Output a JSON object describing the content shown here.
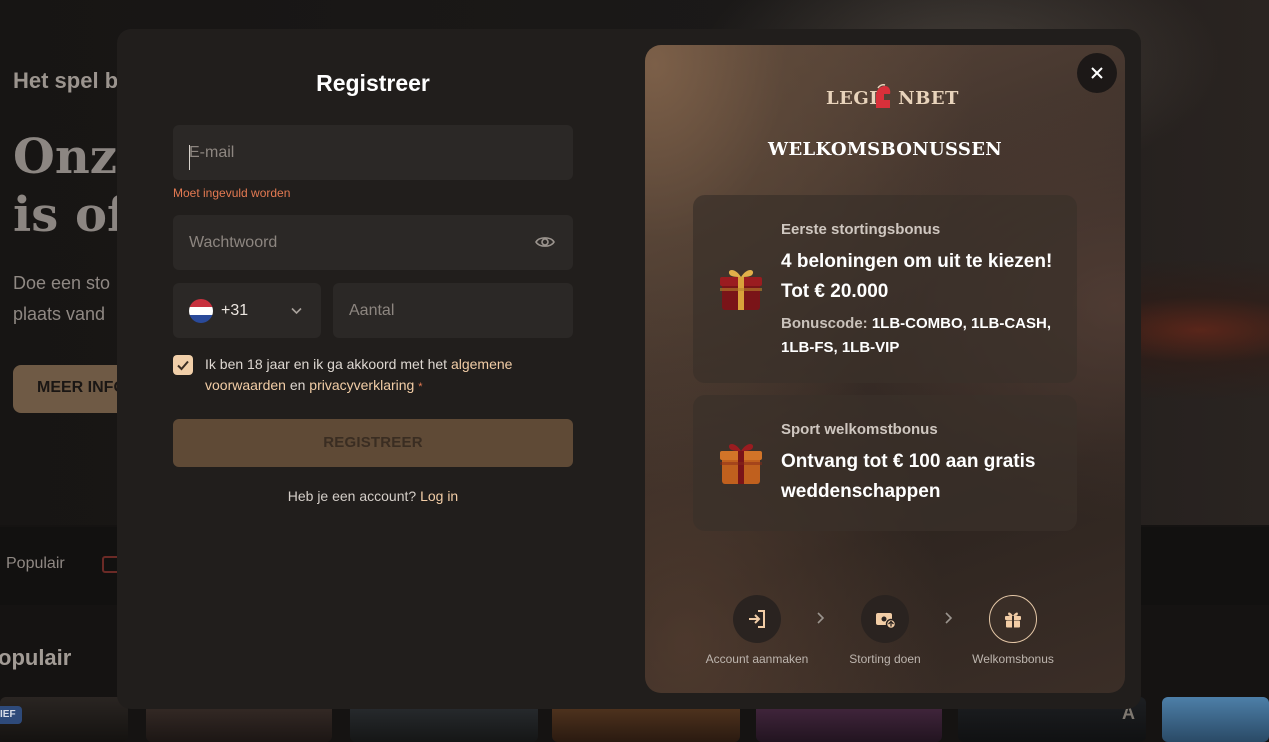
{
  "background": {
    "hero_subtitle": "Het spel b",
    "hero_title_line1": "Onze",
    "hero_title_line2": "is off",
    "hero_text_line1": "Doe een sto",
    "hero_text_line2": "plaats vand",
    "more_button": "MEER INFO",
    "nav_item": "Populair",
    "section_title": "opulair",
    "badge": "IEF",
    "tile_letter": "A"
  },
  "form": {
    "title": "Registreer",
    "email_placeholder": "E-mail",
    "email_error": "Moet ingevuld worden",
    "password_placeholder": "Wachtwoord",
    "phone_prefix": "+31",
    "phone_placeholder": "Aantal",
    "terms_prefix": "Ik ben 18 jaar en ik ga akkoord met het ",
    "terms_link1": "algemene voorwaarden",
    "terms_and": " en ",
    "terms_link2": "privacyverklaring",
    "terms_required": "*",
    "submit_label": "REGISTREER",
    "login_prompt": "Heb je een account? ",
    "login_link": "Log in"
  },
  "bonus": {
    "logo_left": "LEGI",
    "logo_right": "NBET",
    "title": "WELKOMSBONUSSEN",
    "cards": [
      {
        "kicker": "Eerste stortingsbonus",
        "heading_line1": "4 beloningen om uit te kiezen!",
        "heading_line2": "Tot € 20.000",
        "code_label": "Bonuscode: ",
        "code_value": "1LB-COMBO, 1LB-CASH, 1LB-FS, 1LB-VIP"
      },
      {
        "kicker": "Sport welkomstbonus",
        "heading_line1": "Ontvang tot € 100 aan gratis",
        "heading_line2": "weddenschappen"
      }
    ],
    "steps": [
      {
        "label": "Account aanmaken",
        "icon": "login-icon"
      },
      {
        "label": "Storting doen",
        "icon": "deposit-icon"
      },
      {
        "label": "Welkomsbonus",
        "icon": "gift-icon"
      }
    ]
  },
  "colors": {
    "accent": "#f2cda6",
    "error": "#e47a52",
    "logo_red": "#d8303a",
    "modal_bg": "#211e1c",
    "field_bg": "#2b2826"
  }
}
